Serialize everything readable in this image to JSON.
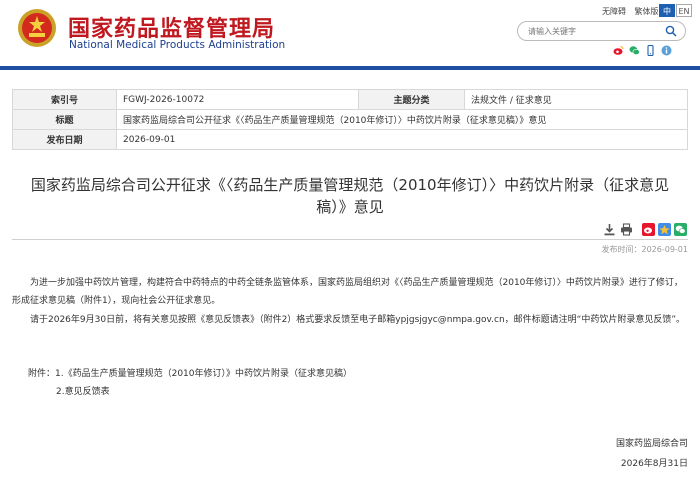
{
  "header": {
    "site_name_cn": "国家药品监督管理局",
    "site_name_en": "National Medical Products Administration",
    "toplinks": [
      "无障碍",
      "繁体版"
    ],
    "lang_cn": "中",
    "lang_en": "EN",
    "search_placeholder": "请输入关键字",
    "social_icons": [
      "weibo-icon",
      "wechat-icon",
      "mobile-icon",
      "info-icon"
    ]
  },
  "meta_table": {
    "index_label": "索引号",
    "index_value": "FGWJ-2026-10072",
    "topic_label": "主题分类",
    "topic_value": "法规文件 / 征求意见",
    "title_label": "标题",
    "title_value": "国家药监局综合司公开征求《〈药品生产质量管理规范（2010年修订）〉中药饮片附录（征求意见稿）》意见",
    "date_label": "发布日期",
    "date_value": "2026-09-01"
  },
  "article": {
    "title": "国家药监局综合司公开征求《〈药品生产质量管理规范（2010年修订）〉中药饮片附录（征求意见稿）》意见",
    "publish_time": "发布时间：2026-09-01",
    "para1": "　　为进一步加强中药饮片管理，构建符合中药特点的中药全链条监管体系，国家药监局组织对《〈药品生产质量管理规范（2010年修订）〉中药饮片附录》进行了修订，形成征求意见稿（附件1），现向社会公开征求意见。",
    "para2": "　　请于2026年9月30日前，将有关意见按照《意见反馈表》（附件2）格式要求反馈至电子邮箱ypjgsjgyc@nmpa.gov.cn，邮件标题请注明“中药饮片附录意见反馈”。",
    "attachment1": "附件：1.《药品生产质量管理规范（2010年修订）》中药饮片附录（征求意见稿）",
    "attachment2": "2.意见反馈表",
    "sign_org": "国家药监局综合司",
    "sign_date": "2026年8月31日"
  }
}
